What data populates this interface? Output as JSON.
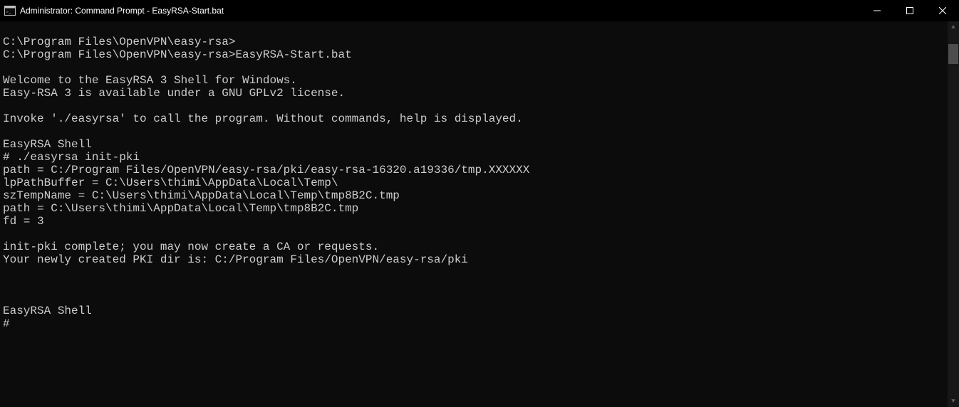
{
  "window": {
    "title": "Administrator: Command Prompt - EasyRSA-Start.bat"
  },
  "terminal": {
    "lines": [
      "",
      "C:\\Program Files\\OpenVPN\\easy-rsa>",
      "C:\\Program Files\\OpenVPN\\easy-rsa>EasyRSA-Start.bat",
      "",
      "Welcome to the EasyRSA 3 Shell for Windows.",
      "Easy-RSA 3 is available under a GNU GPLv2 license.",
      "",
      "Invoke './easyrsa' to call the program. Without commands, help is displayed.",
      "",
      "EasyRSA Shell",
      "# ./easyrsa init-pki",
      "path = C:/Program Files/OpenVPN/easy-rsa/pki/easy-rsa-16320.a19336/tmp.XXXXXX",
      "lpPathBuffer = C:\\Users\\thimi\\AppData\\Local\\Temp\\",
      "szTempName = C:\\Users\\thimi\\AppData\\Local\\Temp\\tmp8B2C.tmp",
      "path = C:\\Users\\thimi\\AppData\\Local\\Temp\\tmp8B2C.tmp",
      "fd = 3",
      "",
      "init-pki complete; you may now create a CA or requests.",
      "Your newly created PKI dir is: C:/Program Files/OpenVPN/easy-rsa/pki",
      "",
      "",
      "",
      "EasyRSA Shell",
      "#"
    ]
  }
}
